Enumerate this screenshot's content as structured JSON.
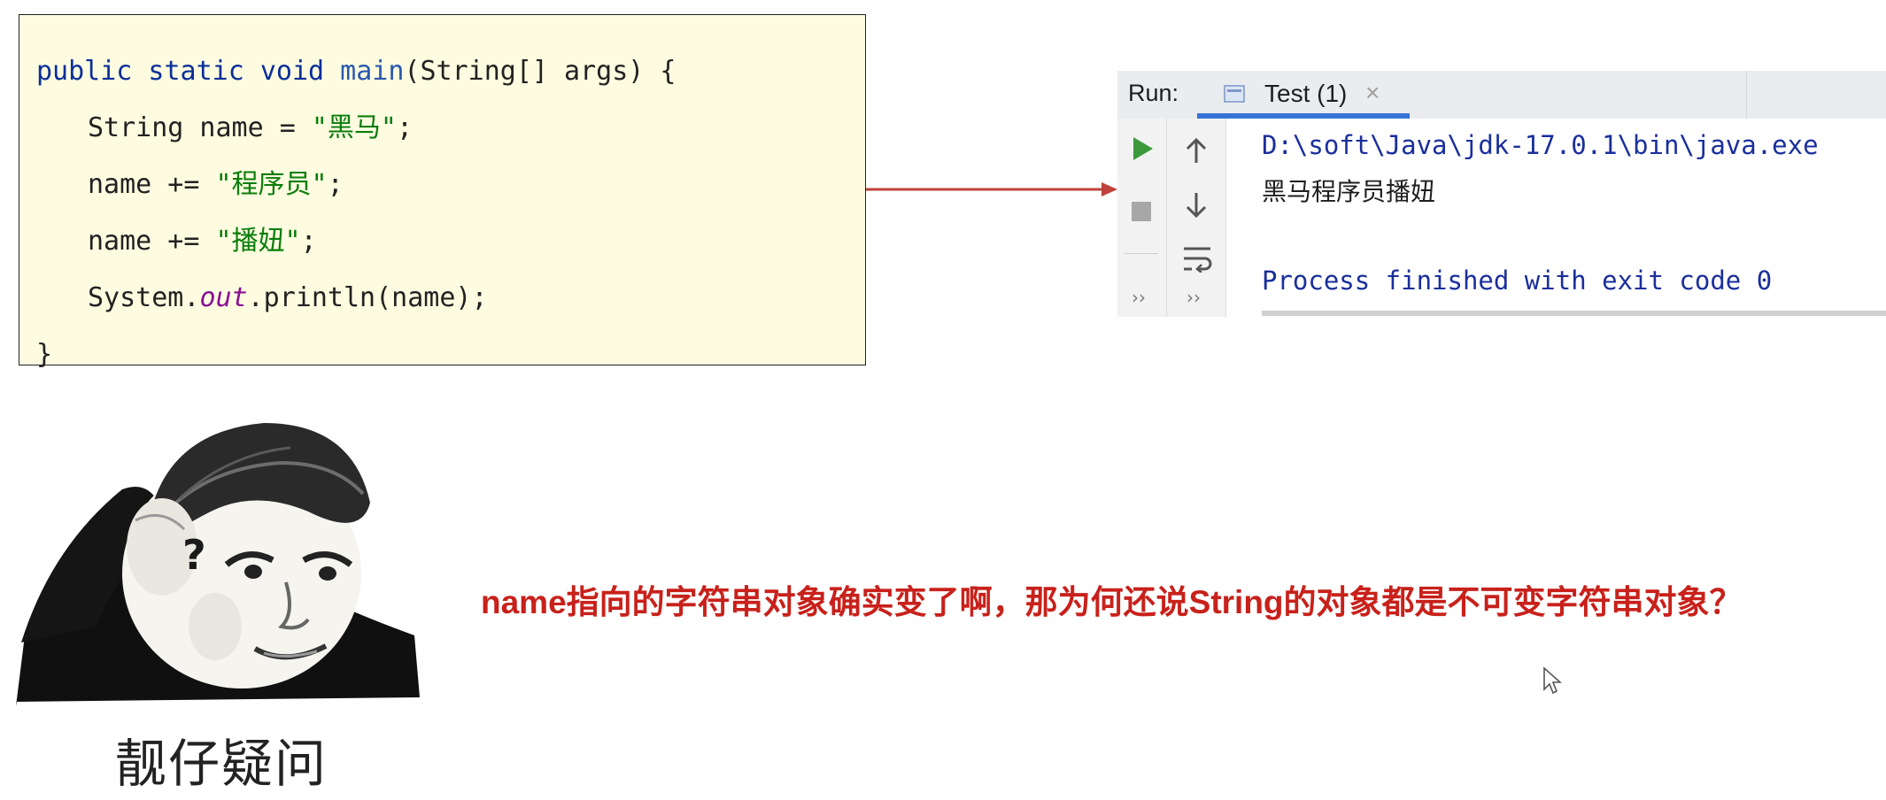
{
  "code": {
    "line1": {
      "kw": "public static void ",
      "fn": "main",
      "rest": "(String[] args) {"
    },
    "line2": {
      "pre": "String name = ",
      "str": "\"黑马\"",
      "post": ";"
    },
    "line3": {
      "pre": "name += ",
      "str": "\"程序员\"",
      "post": ";"
    },
    "line4": {
      "pre": "name += ",
      "str": "\"播妞\"",
      "post": ";"
    },
    "line5": {
      "pre": "System.",
      "field": "out",
      "post": ".println(name);"
    },
    "line6": "}"
  },
  "run_panel": {
    "label": "Run:",
    "tab_title": "Test (1)",
    "tab_close": "×",
    "console": {
      "path": "D:\\soft\\Java\\jdk-17.0.1\\bin\\java.exe",
      "output": "黑马程序员播妞",
      "exit": "Process finished with exit code 0"
    },
    "more": "››",
    "icons": [
      "run-icon",
      "stop-icon",
      "up-arrow-icon",
      "down-arrow-icon",
      "soft-wrap-icon"
    ]
  },
  "meme": {
    "question_mark": "?",
    "caption": "靓仔疑问"
  },
  "question": "name指向的字符串对象确实变了啊，那为何还说String的对象都是不可变字符串对象？",
  "colors": {
    "code_bg": "#fdfce0",
    "keyword": "#0b2e9a",
    "string": "#0a7d0a",
    "field": "#871094",
    "arrow": "#c0413b",
    "question": "#c8211b",
    "run_button": "#3c9a3c",
    "tab_underline": "#3874d8"
  }
}
